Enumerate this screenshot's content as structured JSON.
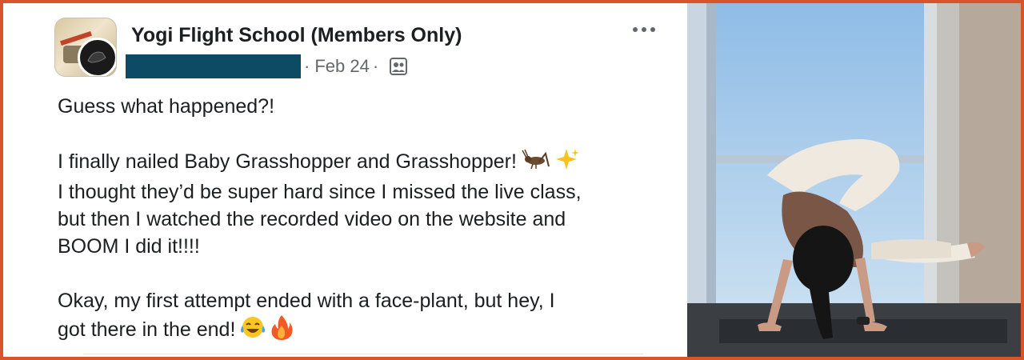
{
  "post": {
    "group_name": "Yogi Flight School (Members Only)",
    "date": "Feb 24",
    "separator": "·",
    "audience_icon": "members-group-icon",
    "more_icon": "more-horizontal-icon",
    "lines": [
      "Guess what happened?!",
      "",
      "I finally nailed Baby Grasshopper and Grasshopper!",
      "I thought they’d be super hard since I missed the live class,",
      "but then I watched the recorded video on the website and",
      "BOOM I did it!!!!",
      "",
      "Okay, my first attempt ended with a face-plant, but hey, I",
      "got there in the end!"
    ],
    "emoji_line_3": [
      "cricket-emoji",
      "sparkles-emoji"
    ],
    "emoji_line_9": [
      "tears-of-joy-emoji",
      "fire-emoji"
    ]
  },
  "photo": {
    "subject": "person-in-arm-balance-yoga-pose"
  },
  "colors": {
    "frame_border": "#d8542a",
    "redaction": "#0d4a63",
    "text": "#1c1e21",
    "meta_text": "#65676b"
  }
}
